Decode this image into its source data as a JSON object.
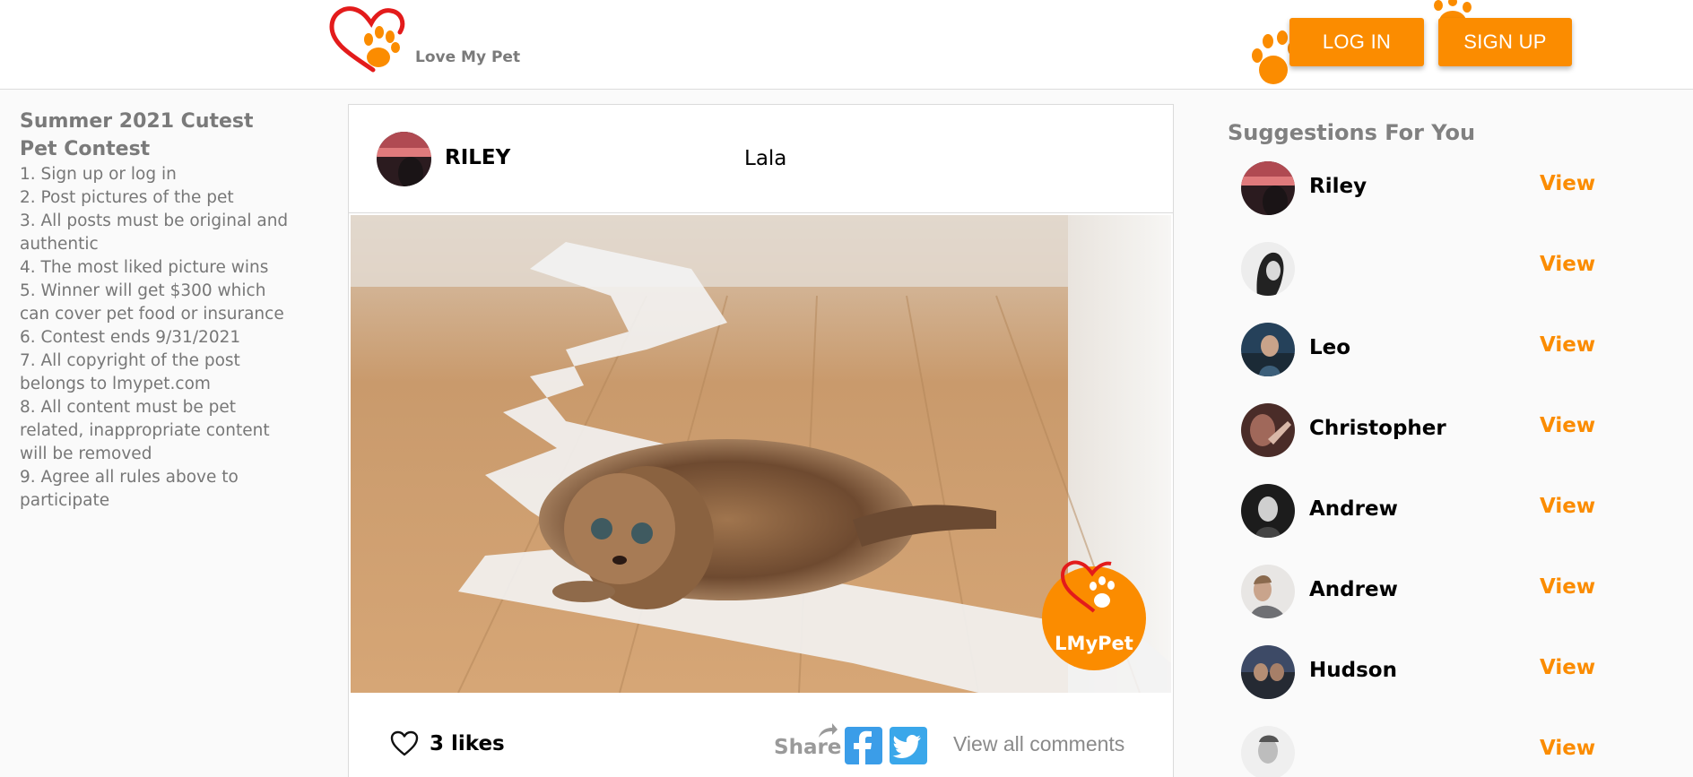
{
  "header": {
    "brand": "Love My Pet",
    "login_label": "LOG IN",
    "signup_label": "SIGN UP",
    "accent_color": "#fb8c00"
  },
  "rules": {
    "title": "Summer 2021 Cutest Pet Contest",
    "items": [
      "1. Sign up or log in",
      "2. Post pictures of the pet",
      "3. All posts must be original and authentic",
      "4. The most liked picture wins",
      "5. Winner will get $300 which can cover pet food or insurance",
      "6. Contest ends 9/31/2021",
      "7. All copyright of the post belongs to lmypet.com",
      "8. All content must be pet related, inappropriate content will be removed",
      "9. Agree all rules above to participate"
    ]
  },
  "post": {
    "username": "RILEY",
    "caption": "Lala",
    "likes": "3 likes",
    "share_label": "Share",
    "view_comments": "View all comments",
    "watermark": "LMyPet"
  },
  "suggestions": {
    "title": "Suggestions For You",
    "view_label": "View",
    "users": [
      {
        "name": "Riley"
      },
      {
        "name": ""
      },
      {
        "name": "Leo"
      },
      {
        "name": "Christopher"
      },
      {
        "name": "Andrew"
      },
      {
        "name": "Andrew"
      },
      {
        "name": "Hudson"
      },
      {
        "name": ""
      }
    ]
  }
}
